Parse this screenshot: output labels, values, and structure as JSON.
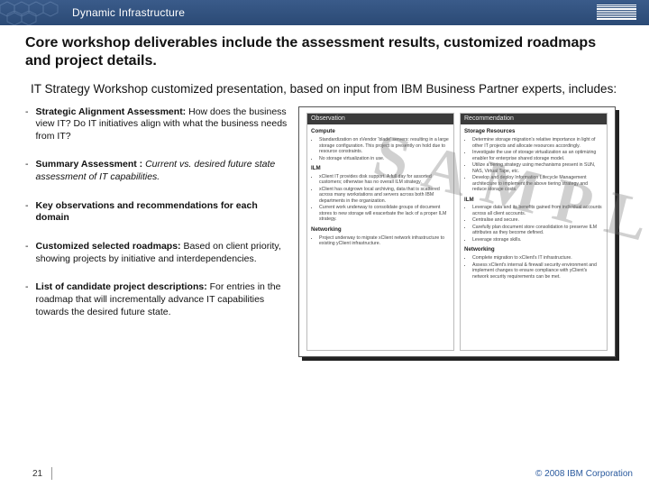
{
  "header": {
    "title": "Dynamic Infrastructure",
    "logo_alt": "IBM"
  },
  "slide": {
    "title": "Core workshop deliverables include the assessment results, customized roadmaps and project details.",
    "intro": "IT Strategy Workshop customized presentation, based on input from IBM Business Partner experts, includes:"
  },
  "bullets": [
    {
      "lead": "Strategic Alignment Assessment:",
      "rest": " How does the business view IT? Do IT initiatives align with what the business needs from IT?",
      "lead_style": "b"
    },
    {
      "lead": "Summary Assessment :",
      "rest": " Current vs. desired future state assessment of IT capabilities.",
      "lead_style": "b",
      "rest_style": "i"
    },
    {
      "lead": "Key observations and recommendations for each domain",
      "rest": "",
      "lead_style": "b"
    },
    {
      "lead": "Customized selected roadmaps:",
      "rest": " Based on client priority, showing projects by initiative and interdependencies.",
      "lead_style": "b"
    },
    {
      "lead": "List of candidate project descriptions:",
      "rest": " For entries in the roadmap that will incrementally advance IT capabilities towards the desired future state.",
      "lead_style": "b"
    }
  ],
  "sample": {
    "watermark": "SAMPLE",
    "left_header": "Observation",
    "right_header": "Recommendation",
    "left": {
      "s1_head": "Compute",
      "s1_items": [
        "Standardization on xVendor ‘blade’ servers: resulting in a large storage configuration. This project is presently on hold due to resource constraints.",
        "No storage virtualization in use."
      ],
      "s2_head": "ILM",
      "s2_items": [
        "xClient IT provides disk support. A full day for assorted customers; otherwise has no overall ILM strategy.",
        "xClient has outgrown local archiving, data that is scattered across many workstations and servers across both IBM departments in the organization.",
        "Current work underway to consolidate groups of document stores to new storage will exacerbate the lack of a proper ILM strategy."
      ],
      "s3_head": "Networking",
      "s3_items": [
        "Project underway to migrate xClient network infrastructure to existing yClient infrastructure."
      ]
    },
    "right": {
      "s1_head": "Storage Resources",
      "s1_items": [
        "Determine storage migration's relative importance in light of other IT projects and allocate resources accordingly.",
        "Investigate the use of storage virtualization as an optimizing enabler for enterprise shared storage model.",
        "Utilize a tiering strategy using mechanisms present in SUN, NAS, Virtual Tape, etc.",
        "Develop and deploy Information Lifecycle Management architecture to implement the above tiering strategy and reduce storage costs."
      ],
      "s2_head": "ILM",
      "s2_items": [
        "Leverage data and its benefits gained from individual accounts across all client accounts.",
        "Centralise and secure.",
        "Carefully plan document store consolidation to preserve ILM attributes as they become defined.",
        "Leverage storage skills."
      ],
      "s3_head": "Networking",
      "s3_items": [
        "Complete migration to xClient's IT infrastructure.",
        "Assess xClient's internal & firewall security environment and implement changes to ensure compliance with yClient's network security requirements can be met."
      ]
    }
  },
  "footer": {
    "page": "21",
    "copyright": "© 2008 IBM Corporation"
  }
}
